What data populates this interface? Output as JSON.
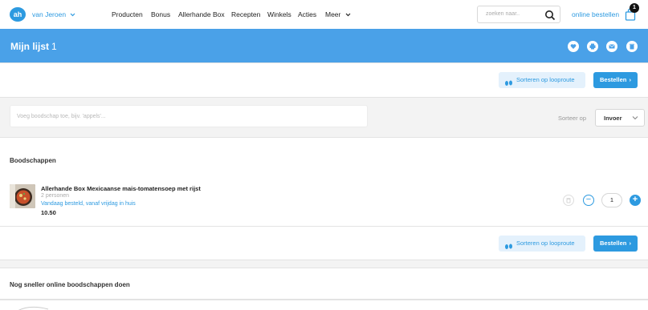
{
  "topnav": {
    "logo": "ah",
    "user_label": "van Jeroen",
    "items": [
      "Producten",
      "Bonus",
      "Allerhande Box",
      "Recepten",
      "Winkels",
      "Acties",
      "Meer"
    ],
    "search_placeholder": "zoeken naar..",
    "online_label": "online bestellen",
    "cart_count": "1"
  },
  "header": {
    "title": "Mijn lijst",
    "count": "1",
    "icons": [
      "heart-icon",
      "print-icon",
      "mail-icon",
      "delete-icon"
    ]
  },
  "actions": {
    "sort_route_label": "Sorteren op looproute",
    "order_label": "Bestellen"
  },
  "add_bar": {
    "placeholder": "Voeg boodschap toe, bijv. 'appels'...",
    "sort_label": "Sorteer op",
    "sort_value": "Invoer"
  },
  "groceries": {
    "section_title": "Boodschappen",
    "items": [
      {
        "name": "Allerhande Box Mexicaanse mais-tomatensoep met rijst",
        "subtitle": "2 personen",
        "delivery": "Vandaag besteld, vanaf vrijdag in huis",
        "price": "10.50",
        "quantity": "1"
      }
    ]
  },
  "promo": {
    "section_title": "Nog sneller online boodschappen doen"
  },
  "colors": {
    "brand_blue": "#2d9ae0",
    "header_blue": "#4aa1e8"
  }
}
